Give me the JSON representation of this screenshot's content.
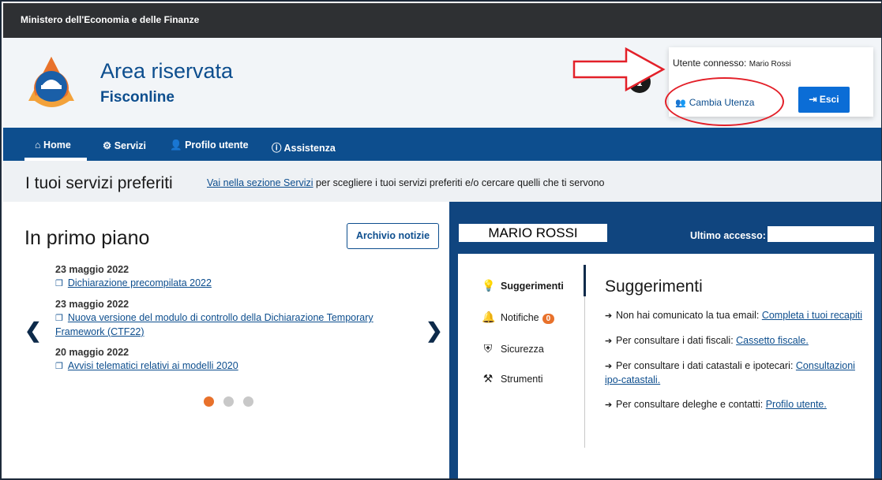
{
  "topbar": {
    "title": "Ministero dell'Economia e delle Finanze"
  },
  "brand": {
    "title": "Area riservata",
    "subtitle": "Fisconline"
  },
  "user_panel": {
    "label": "Utente connesso:",
    "name": "Mario Rossi",
    "change_user": "Cambia Utenza",
    "exit": "Esci"
  },
  "nav": {
    "items": [
      {
        "label": "Home",
        "icon": "home-icon",
        "active": true
      },
      {
        "label": "Servizi",
        "icon": "services-icon"
      },
      {
        "label": "Profilo utente",
        "icon": "user-icon"
      },
      {
        "label": "Assistenza",
        "icon": "info-icon"
      }
    ]
  },
  "favorites": {
    "title": "I tuoi servizi preferiti",
    "link": "Vai nella sezione Servizi",
    "text": " per scegliere i tuoi servizi preferiti e/o cercare quelli che ti servono"
  },
  "news": {
    "title": "In primo piano",
    "archive_button": "Archivio notizie",
    "items": [
      {
        "date": "23 maggio 2022",
        "title": "Dichiarazione precompilata 2022"
      },
      {
        "date": "23 maggio 2022",
        "title": "Nuova versione del modulo di controllo della Dichiarazione Temporary Framework (CTF22)"
      },
      {
        "date": "20 maggio 2022",
        "title": "Avvisi telematici relativi ai modelli 2020"
      }
    ]
  },
  "user_area": {
    "full_name": "MARIO ROSSI",
    "last_access_label": "Ultimo accesso:",
    "tabs": [
      {
        "label": "Suggerimenti",
        "icon": "lightbulb-icon",
        "active": true
      },
      {
        "label": "Notifiche",
        "icon": "bell-icon",
        "badge": "0"
      },
      {
        "label": "Sicurezza",
        "icon": "shield-icon"
      },
      {
        "label": "Strumenti",
        "icon": "tools-icon"
      }
    ],
    "suggestions_title": "Suggerimenti",
    "suggestions": [
      {
        "text": "Non hai comunicato la tua email: ",
        "link": "Completa i tuoi recapiti"
      },
      {
        "text": "Per consultare i dati fiscali: ",
        "link": "Cassetto fiscale."
      },
      {
        "text": "Per consultare i dati catastali e ipotecari: ",
        "link": "Consultazioni ipo-catastali."
      },
      {
        "text": "Per consultare deleghe e contatti: ",
        "link": "Profilo utente."
      }
    ]
  },
  "colors": {
    "brand_blue": "#0d4e8e",
    "accent_orange": "#e8712b",
    "annotation_red": "#e32029"
  }
}
